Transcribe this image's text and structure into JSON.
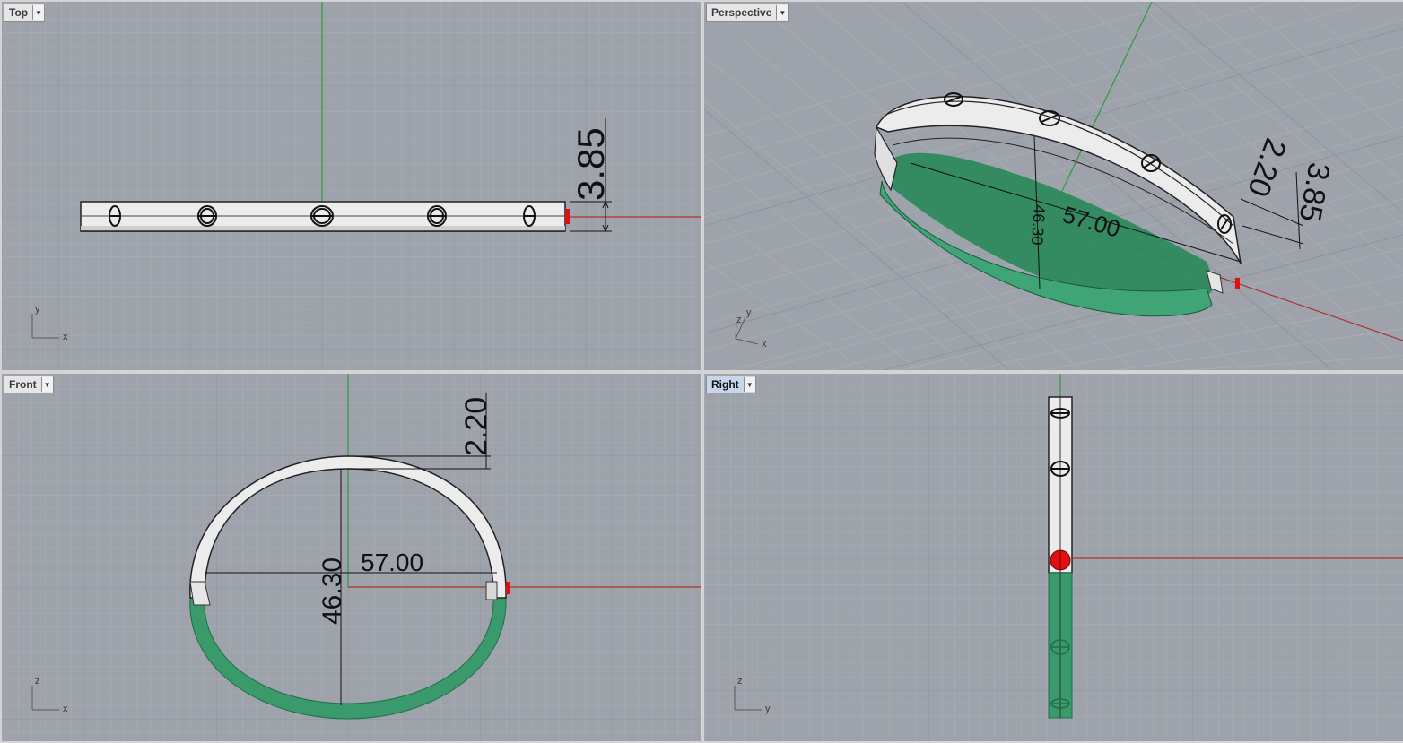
{
  "viewports": {
    "top": {
      "label": "Top",
      "axes": [
        "x",
        "y"
      ],
      "dims": {
        "height": "3.85"
      }
    },
    "perspective": {
      "label": "Perspective",
      "axes": [
        "x",
        "y",
        "z"
      ],
      "dims": {
        "width": "57.00",
        "height": "46.30",
        "top_gap": "2.20",
        "thickness": "3.85"
      }
    },
    "front": {
      "label": "Front",
      "axes": [
        "x",
        "z"
      ],
      "dims": {
        "width": "57.00",
        "height": "46.30",
        "top_gap": "2.20"
      }
    },
    "right": {
      "label": "Right",
      "axes": [
        "y",
        "z"
      ]
    }
  },
  "colors": {
    "viewport_bg": "#9ea3ab",
    "grid_minor": "#a9adb4",
    "grid_major": "#8f949c",
    "x_axis": "#b03030",
    "y_axis": "#2e9a3e",
    "metal": "#e9e9e9",
    "inner_band": "#2e8a5e",
    "pin": "#dd1111"
  }
}
